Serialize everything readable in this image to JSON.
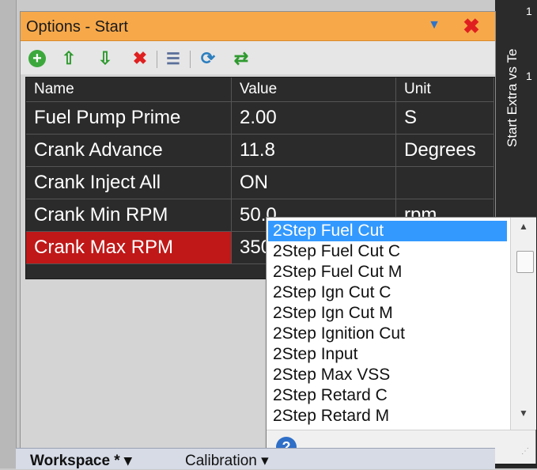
{
  "panel": {
    "title": "Options - Start"
  },
  "side_tab": {
    "label": "Start Extra vs Te",
    "digits": [
      "1",
      "1"
    ]
  },
  "icons": {
    "dropdown": "▼",
    "close": "✖",
    "add": "+",
    "up": "⇧",
    "down": "⇩",
    "delete": "✖",
    "list": "☰",
    "refresh": "⟳",
    "sync": "⇄",
    "help": "?"
  },
  "grid": {
    "headers": {
      "name": "Name",
      "value": "Value",
      "unit": "Unit"
    },
    "rows": [
      {
        "name": "Fuel Pump Prime",
        "value": "2.00",
        "unit": "S"
      },
      {
        "name": "Crank Advance",
        "value": "11.8",
        "unit": "Degrees"
      },
      {
        "name": "Crank Inject All",
        "value": "ON",
        "unit": ""
      },
      {
        "name": "Crank Min RPM",
        "value": "50.0",
        "unit": "rpm"
      },
      {
        "name": "Crank Max RPM",
        "value": "350",
        "unit": ""
      }
    ]
  },
  "popup": {
    "items": [
      "2Step Fuel Cut",
      "2Step Fuel Cut C",
      "2Step Fuel Cut M",
      "2Step Ign Cut C",
      "2Step Ign Cut M",
      "2Step Ignition Cut",
      "2Step Input",
      "2Step Max VSS",
      "2Step Retard C",
      "2Step Retard M"
    ]
  },
  "bottom_tabs": {
    "workspace": "Workspace * ▾",
    "calibration": "Calibration ▾"
  },
  "colors": {
    "title_bar": "#f7a94a",
    "selected_row": "#c01818",
    "highlight": "#3399ff"
  }
}
